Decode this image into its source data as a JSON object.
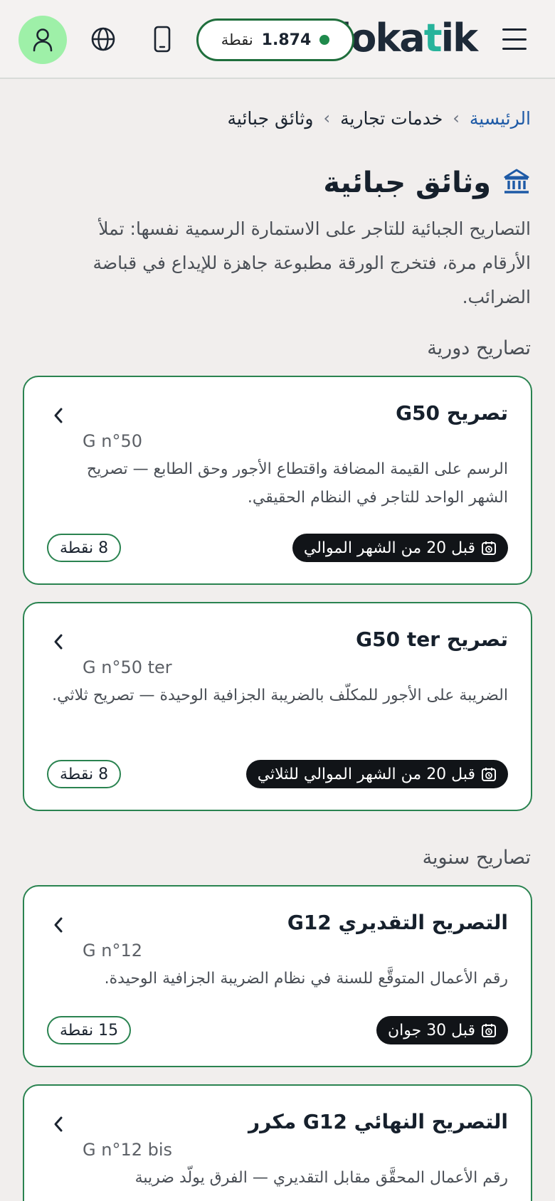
{
  "header": {
    "logo_prefix": "doka",
    "logo_t": "t",
    "logo_suffix": "ik",
    "points_value": "1.874",
    "points_unit": "نقطة",
    "icons": [
      "menu-icon",
      "phone-icon",
      "globe-icon",
      "user-icon"
    ]
  },
  "breadcrumb": {
    "home": "الرئيسية",
    "parent": "خدمات تجارية",
    "current": "وثائق جبائية",
    "separator": "›"
  },
  "page": {
    "title": "وثائق جبائية",
    "title_icon": "bank-icon",
    "description": "التصاريح الجبائية للتاجر على الاستمارة الرسمية نفسها: تملأ الأرقام مرة، فتخرج الورقة مطبوعة جاهزة للإيداع في قباضة الضرائب."
  },
  "sections": {
    "periodic": "تصاريح دورية",
    "annual": "تصاريح سنوية"
  },
  "cards": [
    {
      "title": "تصريح G50",
      "code": "G n°50",
      "description": "الرسم على القيمة المضافة واقتطاع الأجور وحق الطابع — تصريح الشهر الواحد للتاجر في النظام الحقيقي.",
      "due": "قبل 20 من الشهر الموالي",
      "cost": "8 نقطة"
    },
    {
      "title": "تصريح G50 ter",
      "code": "G n°50 ter",
      "description": "الضريبة على الأجور للمكلّف بالضريبة الجزافية الوحيدة — تصريح ثلاثي.",
      "due": "قبل 20 من الشهر الموالي للثلاثي",
      "cost": "8 نقطة"
    },
    {
      "title": "التصريح التقديري G12",
      "code": "G n°12",
      "description": "رقم الأعمال المتوقَّع للسنة في نظام الضريبة الجزافية الوحيدة.",
      "due": "قبل 30 جوان",
      "cost": "15 نقطة"
    },
    {
      "title": "التصريح النهائي G12 مكرر",
      "code": "G n°12 bis",
      "description": "رقم الأعمال المحقَّق مقابل التقديري — الفرق يولّد ضريبة"
    }
  ],
  "colors": {
    "accent_green": "#2a8350",
    "logo_teal": "#27b39b",
    "link_blue": "#1e5aa6",
    "avatar_bg": "#9ef0a8"
  }
}
